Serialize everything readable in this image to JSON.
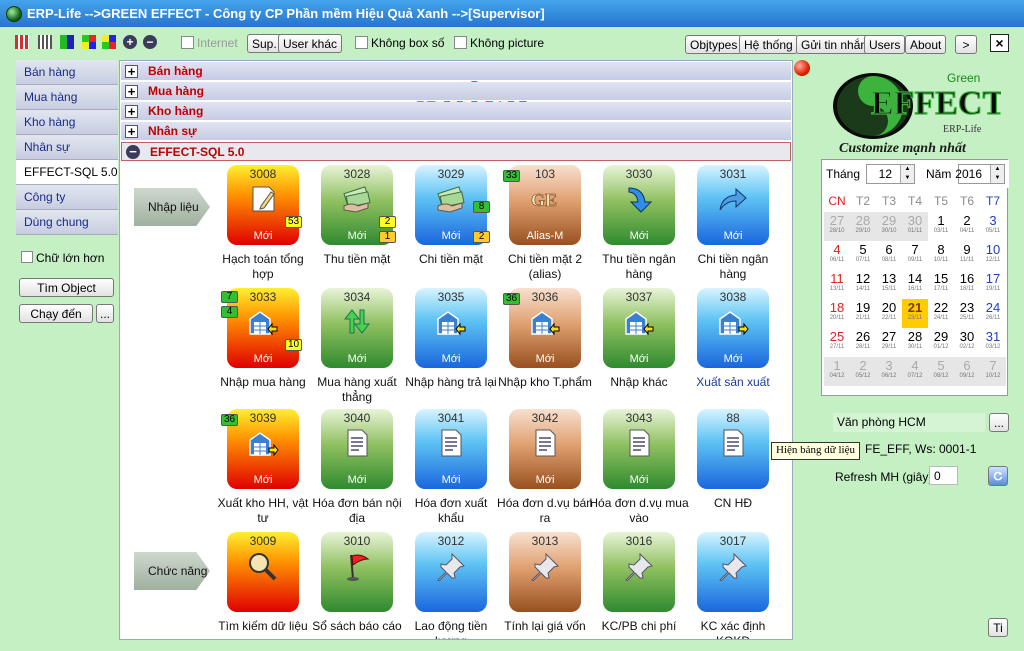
{
  "window": {
    "title": "ERP-Life  -->GREEN EFFECT - Công ty CP Phần mềm Hiệu Quả Xanh -->[Supervisor]"
  },
  "toolbar": {
    "internet_label": "Internet",
    "sup_button": "Sup.",
    "user_other_button": "User khác",
    "no_box_label": "Không box số",
    "no_picture_label": "Không picture",
    "objtypes_button": "Objtypes",
    "system_button": "Hệ thống",
    "send_message_button": "Gửi tin nhắn",
    "users_button": "Users",
    "about_button": "About",
    "next_button": ">",
    "close_button": "×"
  },
  "left_nav": {
    "items": [
      {
        "label": "Bán hàng",
        "active": false
      },
      {
        "label": "Mua hàng",
        "active": false
      },
      {
        "label": "Kho hàng",
        "active": false
      },
      {
        "label": "Nhân sự",
        "active": false
      },
      {
        "label": "EFFECT-SQL 5.0",
        "active": true
      },
      {
        "label": "Công ty",
        "active": false
      },
      {
        "label": "Dùng chung",
        "active": false
      }
    ],
    "bigger_font_label": "Chữ lớn hơn",
    "find_object_button": "Tìm Object",
    "run_to_button": "Chạy đến",
    "more_button": "..."
  },
  "sections": [
    {
      "title": "Bán hàng",
      "open": false
    },
    {
      "title": "Mua hàng",
      "open": false
    },
    {
      "title": "Kho hàng",
      "open": false
    },
    {
      "title": "Nhân sự",
      "open": false
    },
    {
      "title": "EFFECT-SQL 5.0",
      "open": true
    }
  ],
  "watermark": {
    "letters": [
      "u",
      "n",
      "i",
      "c",
      "a"
    ],
    "colors": [
      "#e8792a",
      "#1c9ad6",
      "#1c9ad6",
      "#1c9ad6",
      "#1c9ad6"
    ]
  },
  "groups": {
    "import_label": "Nhập liệu",
    "function_label": "Chức năng"
  },
  "tiles": [
    {
      "num": "3008",
      "label": "Hạch toán tổng hợp",
      "sub": "Mới",
      "color": "red",
      "icon": "document-pen-icon"
    },
    {
      "num": "3028",
      "label": "Thu tiền mặt",
      "sub": "Mới",
      "color": "green",
      "icon": "cash-hand-icon"
    },
    {
      "num": "3029",
      "label": "Chi tiền mặt",
      "sub": "Mới",
      "color": "blue",
      "icon": "cash-hand-icon"
    },
    {
      "num": "103",
      "label": "Chi tiền mặt 2 (alias)",
      "sub": "Alias-M",
      "color": "brown",
      "icon": "ge-text-icon",
      "text": "GE"
    },
    {
      "num": "3030",
      "label": "Thu tiền ngân hàng",
      "sub": "Mới",
      "color": "green",
      "icon": "arrow-down-icon"
    },
    {
      "num": "3031",
      "label": "Chi tiền ngân hàng",
      "sub": "Mới",
      "color": "blue",
      "icon": "arrow-right-icon"
    },
    {
      "num": "3033",
      "label": "Nhập mua hàng",
      "sub": "Mới",
      "color": "red",
      "icon": "warehouse-in-icon"
    },
    {
      "num": "3034",
      "label": "Mua hàng xuất thẳng",
      "sub": "Mới",
      "color": "green",
      "icon": "up-down-arrows-icon"
    },
    {
      "num": "3035",
      "label": "Nhập hàng trả lại",
      "sub": "Mới",
      "color": "blue",
      "icon": "warehouse-in-icon"
    },
    {
      "num": "3036",
      "label": "Nhập kho T.phẩm",
      "sub": "Mới",
      "color": "brown",
      "icon": "warehouse-in-icon"
    },
    {
      "num": "3037",
      "label": "Nhập khác",
      "sub": "Mới",
      "color": "green",
      "icon": "warehouse-in-icon"
    },
    {
      "num": "3038",
      "label": "Xuất sản xuất",
      "sub": "Mới",
      "color": "blue",
      "icon": "warehouse-out-icon",
      "link": true
    },
    {
      "num": "3039",
      "label": "Xuất kho HH, vật tư",
      "sub": "Mới",
      "color": "red",
      "icon": "warehouse-out-icon"
    },
    {
      "num": "3040",
      "label": "Hóa đơn bán nội địa",
      "sub": "Mới",
      "color": "green",
      "icon": "invoice-icon"
    },
    {
      "num": "3041",
      "label": "Hóa đơn xuất khẩu",
      "sub": "Mới",
      "color": "blue",
      "icon": "invoice-icon"
    },
    {
      "num": "3042",
      "label": "Hóa đơn d.vụ bán ra",
      "sub": "Mới",
      "color": "brown",
      "icon": "invoice-icon"
    },
    {
      "num": "3043",
      "label": "Hóa đơn d.vụ mua vào",
      "sub": "Mới",
      "color": "green",
      "icon": "invoice-icon"
    },
    {
      "num": "88",
      "label": "CN HĐ",
      "sub": "",
      "color": "blue",
      "icon": "invoice-icon"
    },
    {
      "num": "3009",
      "label": "Tìm kiếm dữ liệu",
      "sub": "",
      "color": "red",
      "icon": "magnifier-icon"
    },
    {
      "num": "3010",
      "label": "Sổ sách báo cáo",
      "sub": "",
      "color": "green",
      "icon": "flag-icon"
    },
    {
      "num": "3012",
      "label": "Lao động tiền lương",
      "sub": "",
      "color": "blue",
      "icon": "pushpin-icon"
    },
    {
      "num": "3013",
      "label": "Tính lại giá vốn",
      "sub": "",
      "color": "brown",
      "icon": "pushpin-icon"
    },
    {
      "num": "3016",
      "label": "KC/PB chi phí",
      "sub": "",
      "color": "green",
      "icon": "pushpin-icon"
    },
    {
      "num": "3017",
      "label": "KC xác định KQKD",
      "sub": "",
      "color": "blue",
      "icon": "pushpin-icon"
    }
  ],
  "badges": [
    {
      "tile": 0,
      "text": "53",
      "color": "yellow"
    },
    {
      "tile": 1,
      "text": "2",
      "color": "yellow"
    },
    {
      "tile": 1,
      "text": "1",
      "color": "orange"
    },
    {
      "tile": 2,
      "text": "8",
      "color": "green"
    },
    {
      "tile": 2,
      "text": "2",
      "color": "orange"
    },
    {
      "tile": 3,
      "text": "33",
      "color": "green"
    },
    {
      "tile": 6,
      "text": "7",
      "color": "green"
    },
    {
      "tile": 6,
      "text": "4",
      "color": "green"
    },
    {
      "tile": 6,
      "text": "10",
      "color": "yellow"
    },
    {
      "tile": 9,
      "text": "36",
      "color": "green"
    },
    {
      "tile": 12,
      "text": "36",
      "color": "green"
    }
  ],
  "logo": {
    "green": "Green",
    "effect": "EFFECT",
    "erp": "ERP-Life",
    "slogan": "Customize mạnh nhất"
  },
  "calendar": {
    "month_label": "Tháng",
    "month": "12",
    "year_label": "Năm",
    "year": "2016",
    "weekdays": [
      "CN",
      "T2",
      "T3",
      "T4",
      "T5",
      "T6",
      "T7"
    ],
    "weeks": [
      [
        {
          "d": "27",
          "s": "28/10",
          "dim": true
        },
        {
          "d": "28",
          "s": "29/10",
          "dim": true
        },
        {
          "d": "29",
          "s": "30/10",
          "dim": true
        },
        {
          "d": "30",
          "s": "01/11",
          "dim": true
        },
        {
          "d": "1",
          "s": "03/11"
        },
        {
          "d": "2",
          "s": "04/11"
        },
        {
          "d": "3",
          "s": "05/11"
        }
      ],
      [
        {
          "d": "4",
          "s": "06/11"
        },
        {
          "d": "5",
          "s": "07/11"
        },
        {
          "d": "6",
          "s": "08/11"
        },
        {
          "d": "7",
          "s": "09/11"
        },
        {
          "d": "8",
          "s": "10/11"
        },
        {
          "d": "9",
          "s": "11/11"
        },
        {
          "d": "10",
          "s": "12/11"
        }
      ],
      [
        {
          "d": "11",
          "s": "13/11"
        },
        {
          "d": "12",
          "s": "14/11"
        },
        {
          "d": "13",
          "s": "15/11"
        },
        {
          "d": "14",
          "s": "16/11"
        },
        {
          "d": "15",
          "s": "17/11"
        },
        {
          "d": "16",
          "s": "18/11"
        },
        {
          "d": "17",
          "s": "19/11"
        }
      ],
      [
        {
          "d": "18",
          "s": "20/11"
        },
        {
          "d": "19",
          "s": "21/11"
        },
        {
          "d": "20",
          "s": "22/11"
        },
        {
          "d": "21",
          "s": "23/11",
          "today": true
        },
        {
          "d": "22",
          "s": "24/11"
        },
        {
          "d": "23",
          "s": "25/11"
        },
        {
          "d": "24",
          "s": "26/11"
        }
      ],
      [
        {
          "d": "25",
          "s": "27/11"
        },
        {
          "d": "26",
          "s": "28/11"
        },
        {
          "d": "27",
          "s": "29/11"
        },
        {
          "d": "28",
          "s": "30/11"
        },
        {
          "d": "29",
          "s": "01/12"
        },
        {
          "d": "30",
          "s": "02/12"
        },
        {
          "d": "31",
          "s": "03/12"
        }
      ],
      [
        {
          "d": "1",
          "s": "04/12",
          "dim": true
        },
        {
          "d": "2",
          "s": "05/12",
          "dim": true
        },
        {
          "d": "3",
          "s": "06/12",
          "dim": true
        },
        {
          "d": "4",
          "s": "07/12",
          "dim": true
        },
        {
          "d": "5",
          "s": "08/12",
          "dim": true
        },
        {
          "d": "6",
          "s": "09/12",
          "dim": true
        },
        {
          "d": "7",
          "s": "10/12",
          "dim": true
        }
      ]
    ]
  },
  "office": {
    "value": "Văn phòng HCM",
    "more_button": "..."
  },
  "info_text": "FE_EFF, Ws: 0001-1",
  "tooltip": "Hiện bảng dữ liệu",
  "refresh": {
    "label": "Refresh MH (giây)",
    "value": "0"
  },
  "ti_button": "Ti"
}
